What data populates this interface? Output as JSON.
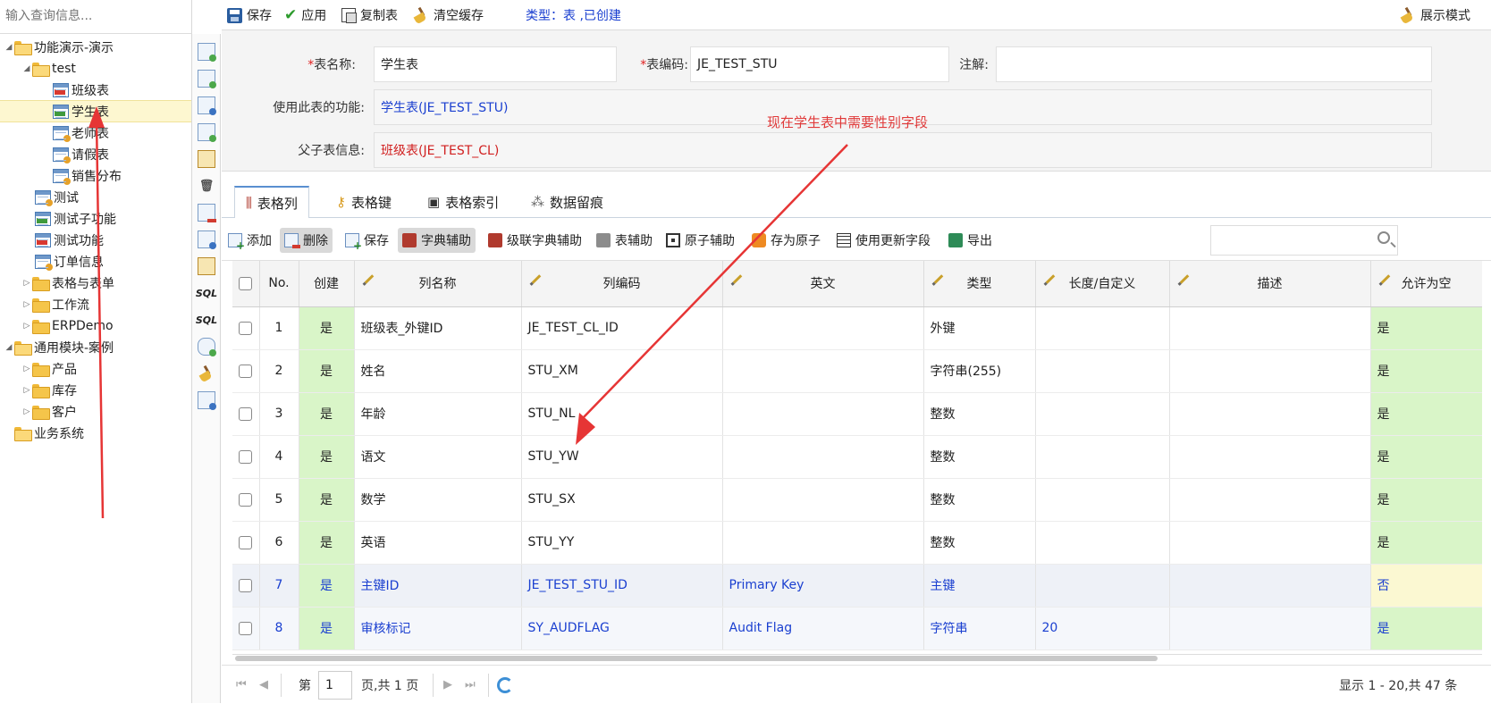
{
  "left": {
    "search_placeholder": "输入查询信息...",
    "tree": [
      {
        "label": "功能演示-演示",
        "twisty": "◢"
      },
      {
        "label": "test",
        "twisty": "◢"
      },
      {
        "label": "班级表"
      },
      {
        "label": "学生表"
      },
      {
        "label": "老师表"
      },
      {
        "label": "请假表"
      },
      {
        "label": "销售分布"
      },
      {
        "label": "测试"
      },
      {
        "label": "测试子功能"
      },
      {
        "label": "测试功能"
      },
      {
        "label": "订单信息"
      },
      {
        "label": "表格与表单",
        "twisty": "▷"
      },
      {
        "label": "工作流",
        "twisty": "▷"
      },
      {
        "label": "ERPDemo",
        "twisty": "▷"
      },
      {
        "label": "通用模块-案例",
        "twisty": "◢"
      },
      {
        "label": "产品",
        "twisty": "▷"
      },
      {
        "label": "库存",
        "twisty": "▷"
      },
      {
        "label": "客户",
        "twisty": "▷"
      },
      {
        "label": "业务系统"
      }
    ]
  },
  "vtools": {
    "sql1": "SQL",
    "sql2": "SQL"
  },
  "toolbar": {
    "save": "保存",
    "apply": "应用",
    "copy": "复制表",
    "clear_cache": "清空缓存",
    "type_info": "类型：表 ,已创建",
    "display_mode": "展示模式"
  },
  "form": {
    "table_name_label": "表名称:",
    "table_name_value": "学生表",
    "table_code_label": "表编码:",
    "table_code_value": "JE_TEST_STU",
    "comment_label": "注解:",
    "comment_value": "",
    "used_by_label": "使用此表的功能:",
    "used_by_value": "学生表(JE_TEST_STU)",
    "parent_label": "父子表信息:",
    "parent_value": "班级表(JE_TEST_CL)",
    "required_mark": "*"
  },
  "annotation": "现在学生表中需要性别字段",
  "tabs": [
    {
      "label": "表格列"
    },
    {
      "label": "表格键"
    },
    {
      "label": "表格索引"
    },
    {
      "label": "数据留痕"
    }
  ],
  "grid_toolbar": {
    "add": "添加",
    "delete": "删除",
    "save": "保存",
    "dict_helper": "字典辅助",
    "cascade_dict_helper": "级联字典辅助",
    "table_helper": "表辅助",
    "atom_helper": "原子辅助",
    "save_as_atom": "存为原子",
    "use_update_field": "使用更新字段",
    "export": "导出"
  },
  "grid": {
    "headers": {
      "no": "No.",
      "create": "创建",
      "col_name": "列名称",
      "col_code": "列编码",
      "english": "英文",
      "type": "类型",
      "length": "长度/自定义",
      "desc": "描述",
      "nullable": "允许为空"
    },
    "rows": [
      {
        "no": "1",
        "create": "是",
        "col_name": "班级表_外键ID",
        "col_code": "JE_TEST_CL_ID",
        "english": "",
        "type": "外键",
        "length": "",
        "desc": "",
        "nullable": "是"
      },
      {
        "no": "2",
        "create": "是",
        "col_name": "姓名",
        "col_code": "STU_XM",
        "english": "",
        "type": "字符串(255)",
        "length": "",
        "desc": "",
        "nullable": "是"
      },
      {
        "no": "3",
        "create": "是",
        "col_name": "年龄",
        "col_code": "STU_NL",
        "english": "",
        "type": "整数",
        "length": "",
        "desc": "",
        "nullable": "是"
      },
      {
        "no": "4",
        "create": "是",
        "col_name": "语文",
        "col_code": "STU_YW",
        "english": "",
        "type": "整数",
        "length": "",
        "desc": "",
        "nullable": "是"
      },
      {
        "no": "5",
        "create": "是",
        "col_name": "数学",
        "col_code": "STU_SX",
        "english": "",
        "type": "整数",
        "length": "",
        "desc": "",
        "nullable": "是"
      },
      {
        "no": "6",
        "create": "是",
        "col_name": "英语",
        "col_code": "STU_YY",
        "english": "",
        "type": "整数",
        "length": "",
        "desc": "",
        "nullable": "是"
      },
      {
        "no": "7",
        "create": "是",
        "col_name": "主键ID",
        "col_code": "JE_TEST_STU_ID",
        "english": "Primary Key",
        "type": "主键",
        "length": "",
        "desc": "",
        "nullable": "否"
      },
      {
        "no": "8",
        "create": "是",
        "col_name": "审核标记",
        "col_code": "SY_AUDFLAG",
        "english": "Audit Flag",
        "type": "字符串",
        "length": "20",
        "desc": "",
        "nullable": "是"
      }
    ]
  },
  "pager": {
    "page_prefix": "第",
    "page_value": "1",
    "page_suffix": "页,共 1 页",
    "summary": "显示 1 - 20,共 47 条"
  },
  "colors": {
    "accent_blue": "#1a3fd0",
    "required_red": "#e02020",
    "create_green": "#d9f5c8",
    "annotation_red": "#e03a3a"
  }
}
